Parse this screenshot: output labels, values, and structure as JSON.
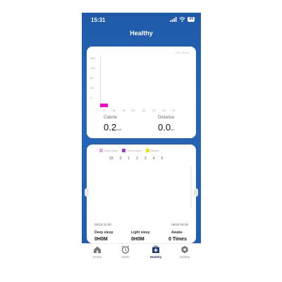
{
  "status_bar": {
    "time": "15:31",
    "battery": "99"
  },
  "header": {
    "title": "Healthy"
  },
  "activity_card": {
    "unit_note": "Unit: Steps",
    "y_ticks": [
      "160",
      "120",
      "80",
      "40",
      "0"
    ],
    "x_ticks": [
      "17",
      "18",
      "19",
      "20",
      "21",
      "22",
      "23",
      "24"
    ],
    "bar_color": "#ff00cc",
    "calorie_label": "Calorie",
    "calorie_value": "0.2",
    "calorie_unit": "kcal",
    "distance_label": "Distance",
    "distance_value": "0.0",
    "distance_unit": "km"
  },
  "sleep_card": {
    "legend": [
      {
        "label": "Light sleep",
        "color": "#e6a8ef"
      },
      {
        "label": "Deep sleep",
        "color": "#9d37d6"
      },
      {
        "label": "Awake",
        "color": "#f2e300"
      }
    ],
    "hours": [
      "23",
      "0",
      "1",
      "2",
      "3",
      "4",
      "5"
    ],
    "start_time": "06/23 22:00",
    "end_time": "06/24 06:00",
    "deep_label": "Deep sleep",
    "deep_value": "0H0M",
    "light_label": "Light sleep",
    "light_value": "0H0M",
    "awake_label": "Awake",
    "awake_value": "0 Times"
  },
  "tab_bar": {
    "tabs": [
      {
        "label": "Home",
        "icon": "home-icon",
        "active": false
      },
      {
        "label": "Alarm",
        "icon": "alarm-clock-icon",
        "active": false
      },
      {
        "label": "Healthy",
        "icon": "medical-kit-icon",
        "active": true
      },
      {
        "label": "Setting",
        "icon": "gear-icon",
        "active": false
      }
    ]
  },
  "chart_data": {
    "type": "bar",
    "categories": [
      "17",
      "18",
      "19",
      "20",
      "21",
      "22",
      "23",
      "24"
    ],
    "values": [
      12,
      0,
      0,
      0,
      0,
      0,
      0,
      0
    ],
    "xlabel": "",
    "ylabel": "Unit: Steps",
    "ylim": [
      0,
      160
    ],
    "grid": false
  }
}
